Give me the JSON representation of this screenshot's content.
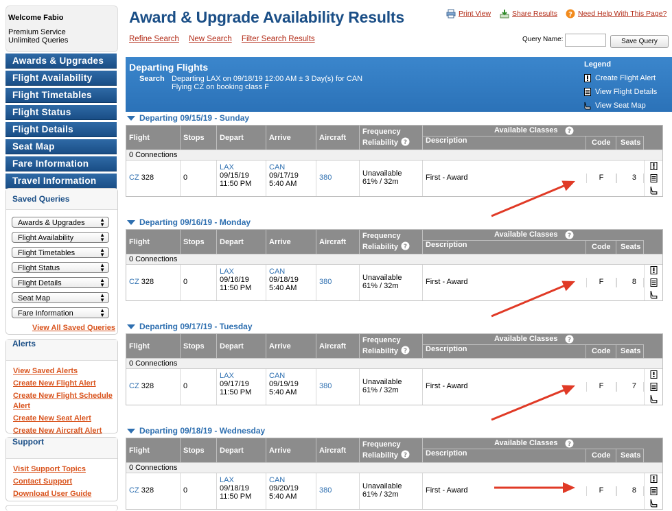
{
  "sidebar": {
    "welcome": "Welcome Fabio",
    "service_line1": "Premium Service",
    "service_line2": "Unlimited Queries",
    "nav": [
      "Awards & Upgrades",
      "Flight Availability",
      "Flight Timetables",
      "Flight Status",
      "Flight Details",
      "Seat Map",
      "Fare Information",
      "Travel Information"
    ],
    "saved_queries": {
      "title": "Saved Queries",
      "selects": [
        "Awards & Upgrades",
        "Flight Availability",
        "Flight Timetables",
        "Flight Status",
        "Flight Details",
        "Seat Map",
        "Fare Information"
      ],
      "view_all": "View All Saved Queries"
    },
    "alerts": {
      "title": "Alerts",
      "links": [
        "View Saved Alerts",
        "Create New Flight Alert",
        "Create New Flight Schedule Alert",
        "Create New Seat Alert",
        "Create New Aircraft Alert"
      ]
    },
    "support": {
      "title": "Support",
      "links": [
        "Visit Support Topics",
        "Contact Support",
        "Download User Guide"
      ]
    }
  },
  "header": {
    "title": "Award & Upgrade Availability Results",
    "print": "Print View",
    "share": "Share Results",
    "help": "Need Help With This Page?",
    "subnav": [
      "Refine Search",
      "New Search",
      "Filter Search Results"
    ],
    "query_name_label": "Query Name:",
    "save_query": "Save Query"
  },
  "departing": {
    "title": "Departing Flights",
    "search_label": "Search",
    "search_line1": "Departing LAX on 09/18/19 12:00 AM ± 3 Day(s) for CAN",
    "search_line2": "Flying CZ on booking class F",
    "legend": {
      "title": "Legend",
      "items": [
        "Create Flight Alert",
        "View Flight Details",
        "View Seat Map"
      ]
    }
  },
  "table_headers": {
    "flight": "Flight",
    "stops": "Stops",
    "depart": "Depart",
    "arrive": "Arrive",
    "aircraft": "Aircraft",
    "freq1": "Frequency",
    "freq2": "Reliability",
    "available_classes": "Available Classes",
    "description": "Description",
    "code": "Code",
    "seats": "Seats"
  },
  "days": [
    {
      "title": "Departing 09/15/19 - Sunday",
      "connections": "0 Connections",
      "airline": "CZ",
      "flight_no": "328",
      "stops": "0",
      "dep_airport": "LAX",
      "dep_date": "09/15/19",
      "dep_time": "11:50 PM",
      "arr_airport": "CAN",
      "arr_date": "09/17/19",
      "arr_time": "5:40 AM",
      "aircraft": "380",
      "freq": "Unavailable",
      "reliability": "61% / 32m",
      "description": "First - Award",
      "code": "F",
      "seats": "3"
    },
    {
      "title": "Departing 09/16/19 - Monday",
      "connections": "0 Connections",
      "airline": "CZ",
      "flight_no": "328",
      "stops": "0",
      "dep_airport": "LAX",
      "dep_date": "09/16/19",
      "dep_time": "11:50 PM",
      "arr_airport": "CAN",
      "arr_date": "09/18/19",
      "arr_time": "5:40 AM",
      "aircraft": "380",
      "freq": "Unavailable",
      "reliability": "61% / 32m",
      "description": "First - Award",
      "code": "F",
      "seats": "8"
    },
    {
      "title": "Departing 09/17/19 - Tuesday",
      "connections": "0 Connections",
      "airline": "CZ",
      "flight_no": "328",
      "stops": "0",
      "dep_airport": "LAX",
      "dep_date": "09/17/19",
      "dep_time": "11:50 PM",
      "arr_airport": "CAN",
      "arr_date": "09/19/19",
      "arr_time": "5:40 AM",
      "aircraft": "380",
      "freq": "Unavailable",
      "reliability": "61% / 32m",
      "description": "First - Award",
      "code": "F",
      "seats": "7"
    },
    {
      "title": "Departing 09/18/19 - Wednesday",
      "connections": "0 Connections",
      "airline": "CZ",
      "flight_no": "328",
      "stops": "0",
      "dep_airport": "LAX",
      "dep_date": "09/18/19",
      "dep_time": "11:50 PM",
      "arr_airport": "CAN",
      "arr_date": "09/20/19",
      "arr_time": "5:40 AM",
      "aircraft": "380",
      "freq": "Unavailable",
      "reliability": "61% / 32m",
      "description": "First - Award",
      "code": "F",
      "seats": "8"
    }
  ],
  "colors": {
    "brand_blue": "#1a4e86",
    "link_red": "#b22a16",
    "link_orange": "#d9541e",
    "arrow_red": "#e03a26",
    "header_gray": "#8c8c8c"
  }
}
